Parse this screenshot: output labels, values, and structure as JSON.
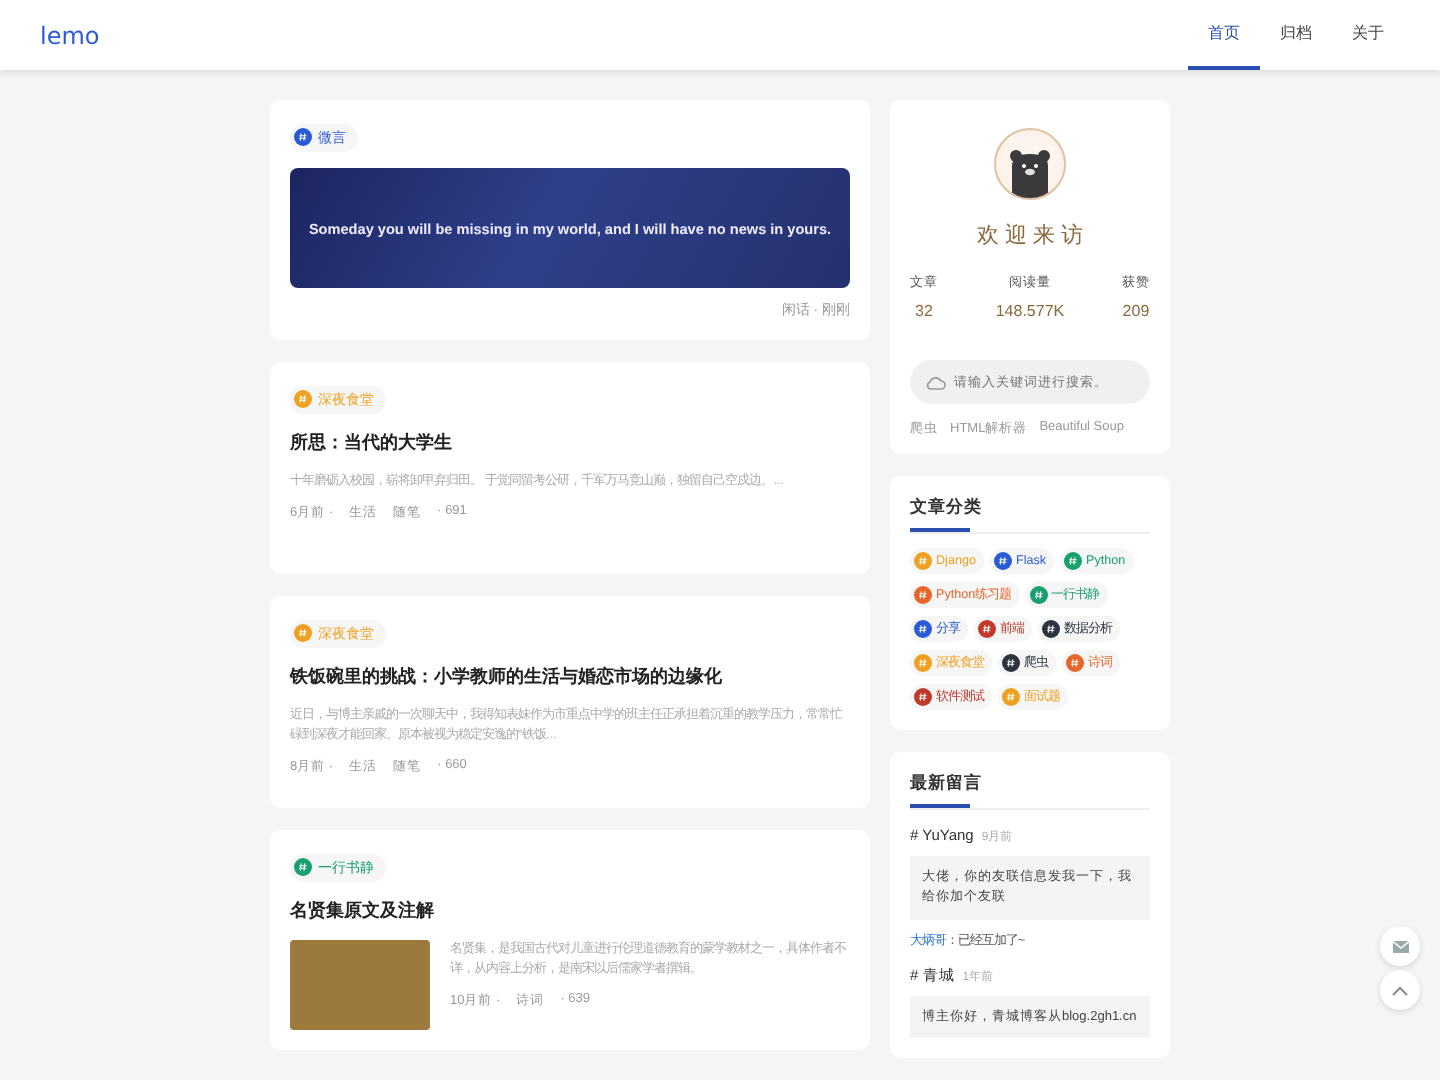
{
  "header": {
    "logo": "lemo",
    "nav": [
      {
        "label": "首页",
        "selected": true
      },
      {
        "label": "归档",
        "selected": false
      },
      {
        "label": "关于",
        "selected": false
      }
    ]
  },
  "posts": [
    {
      "kind": "quote",
      "tag": {
        "label": "微言",
        "color": "#2a5bd7"
      },
      "quote": "Someday you will be missing in my world, and I will have no news in yours.",
      "footer": "闲话 · 刚刚"
    },
    {
      "kind": "text",
      "tag": {
        "label": "深夜食堂",
        "color": "#f0a020"
      },
      "title": "所思：当代的大学生",
      "excerpt": "十年磨砺入校园，崭将卸甲弃归田。 于觉同留考公研，千军万马竞山巅，独留自己空戍边。...",
      "meta": [
        "6月前 ·",
        "生活",
        "随笔",
        "· 691"
      ]
    },
    {
      "kind": "text",
      "tag": {
        "label": "深夜食堂",
        "color": "#f0a020"
      },
      "title": "铁饭碗里的挑战：小学教师的生活与婚恋市场的边缘化",
      "excerpt": "近日，与博主亲戚的一次聊天中，我得知表妹作为市重点中学的班主任正承担着沉重的教学压力，常常忙碌到深夜才能回家。原本被视为稳定安逸的“铁饭...",
      "meta": [
        "8月前 ·",
        "生活",
        "随笔",
        "· 660"
      ]
    },
    {
      "kind": "image",
      "tag": {
        "label": "一行书静",
        "color": "#1aa06d"
      },
      "title": "名贤集原文及注解",
      "excerpt": "名贤集，是我国古代对儿童进行伦理道德教育的蒙学教材之一，具体作者不详，从内容上分析，是南宋以后儒家学者撰辑。",
      "meta": [
        "10月前 ·",
        "诗词",
        "· 639"
      ]
    }
  ],
  "profile": {
    "greeting": "欢 迎 来 访",
    "stats": [
      {
        "label": "文章",
        "value": "32"
      },
      {
        "label": "阅读量",
        "value": "148.577K"
      },
      {
        "label": "获赞",
        "value": "209"
      }
    ],
    "search": {
      "placeholder": "请输入关键词进行搜索。"
    },
    "hot_words": [
      "爬虫",
      "HTML解析器",
      "Beautiful Soup"
    ]
  },
  "categories": {
    "title": "文章分类",
    "items": [
      {
        "label": "Django",
        "color": "#f0a020"
      },
      {
        "label": "Flask",
        "color": "#2a5bd7"
      },
      {
        "label": "Python",
        "color": "#1aa06d"
      },
      {
        "label": "Python练习题",
        "color": "#e8662a"
      },
      {
        "label": "一行书静",
        "color": "#1aa06d"
      },
      {
        "label": "分享",
        "color": "#2a5bd7"
      },
      {
        "label": "前端",
        "color": "#c0392b"
      },
      {
        "label": "数据分析",
        "color": "#2d3440"
      },
      {
        "label": "深夜食堂",
        "color": "#f0a020"
      },
      {
        "label": "爬虫",
        "color": "#2d3440"
      },
      {
        "label": "诗词",
        "color": "#e8662a"
      },
      {
        "label": "软件测试",
        "color": "#c0392b"
      },
      {
        "label": "面试题",
        "color": "#f0a020"
      }
    ]
  },
  "comments": {
    "title": "最新留言",
    "items": [
      {
        "author": "# YuYang",
        "time": "9月前",
        "text": "大佬，你的友联信息发我一下，我给你加个友联",
        "reply": {
          "author": "大炳哥",
          "text": "：已经互加了~"
        }
      },
      {
        "author": "# 青城",
        "time": "1年前",
        "text": "博主你好，青城博客从blog.2gh1.cn"
      }
    ]
  }
}
